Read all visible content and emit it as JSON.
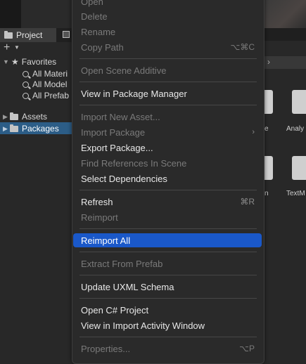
{
  "project_tab": {
    "label": "Project"
  },
  "favorites": {
    "label": "Favorites",
    "items": [
      "All Materi",
      "All Model",
      "All Prefab"
    ]
  },
  "tree": {
    "assets": "Assets",
    "packages": "Packages"
  },
  "right_panel": {
    "labels": [
      "e",
      "Analy",
      "n",
      "TextM"
    ]
  },
  "menu": {
    "items": [
      {
        "label": "Open",
        "shortcut": "",
        "disabled": true
      },
      {
        "label": "Delete",
        "shortcut": "",
        "disabled": true
      },
      {
        "label": "Rename",
        "shortcut": "",
        "disabled": true
      },
      {
        "label": "Copy Path",
        "shortcut": "⌥⌘C",
        "disabled": true
      },
      {
        "label": "Open Scene Additive",
        "shortcut": "",
        "disabled": true
      },
      {
        "label": "View in Package Manager",
        "shortcut": "",
        "disabled": false
      },
      {
        "label": "Import New Asset...",
        "shortcut": "",
        "disabled": true
      },
      {
        "label": "Import Package",
        "shortcut": "",
        "disabled": true,
        "submenu": true
      },
      {
        "label": "Export Package...",
        "shortcut": "",
        "disabled": false
      },
      {
        "label": "Find References In Scene",
        "shortcut": "",
        "disabled": true
      },
      {
        "label": "Select Dependencies",
        "shortcut": "",
        "disabled": false
      },
      {
        "label": "Refresh",
        "shortcut": "⌘R",
        "disabled": false
      },
      {
        "label": "Reimport",
        "shortcut": "",
        "disabled": true
      },
      {
        "label": "Reimport All",
        "shortcut": "",
        "disabled": false,
        "highlighted": true
      },
      {
        "label": "Extract From Prefab",
        "shortcut": "",
        "disabled": true
      },
      {
        "label": "Update UXML Schema",
        "shortcut": "",
        "disabled": false
      },
      {
        "label": "Open C# Project",
        "shortcut": "",
        "disabled": false
      },
      {
        "label": "View in Import Activity Window",
        "shortcut": "",
        "disabled": false
      },
      {
        "label": "Properties...",
        "shortcut": "⌥P",
        "disabled": true
      }
    ],
    "submenu_arrow": "›"
  },
  "icons": {
    "favorites": "star-icon",
    "search": "search-icon",
    "folder": "folder-icon",
    "add": "plus-icon"
  },
  "colors": {
    "highlight": "#1a58c9",
    "selection": "#2c5d87",
    "menu_bg": "#2a2a2a"
  }
}
